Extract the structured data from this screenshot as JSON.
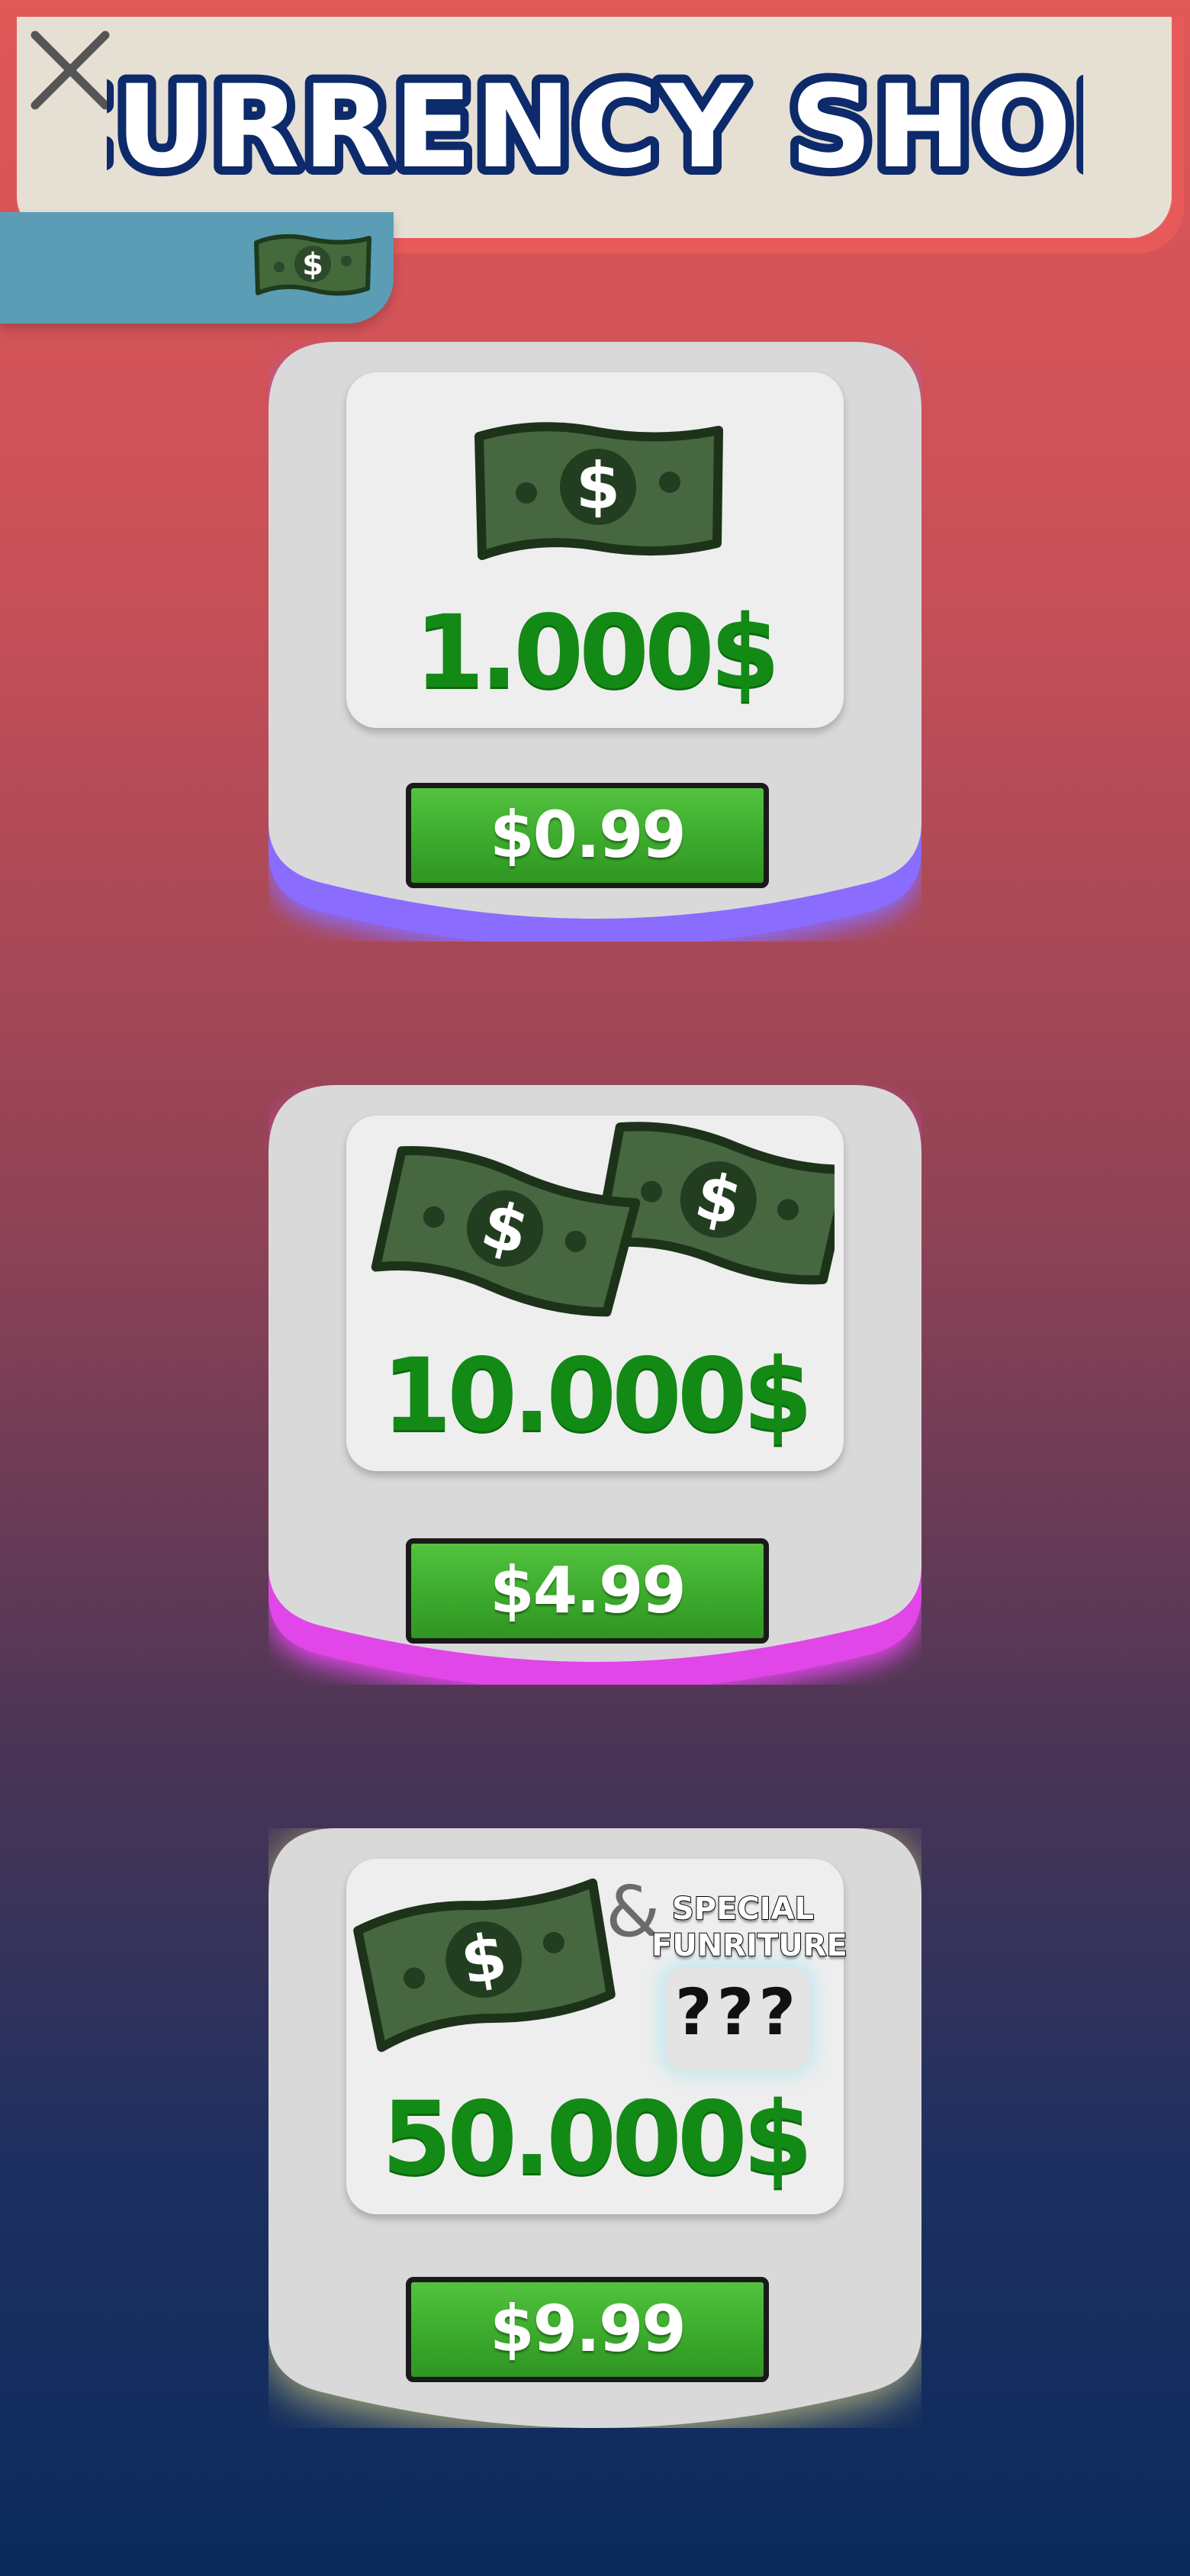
{
  "header": {
    "title": "CURRENCY SHOP",
    "close_icon": "close-x-icon"
  },
  "wallet": {
    "icon": "cash-icon"
  },
  "offers": [
    {
      "amount": "1.000$",
      "price": "$0.99",
      "glow_color": "#8a6cff",
      "icon": "single-bill-icon"
    },
    {
      "amount": "10.000$",
      "price": "$4.99",
      "glow_color": "#e046e8",
      "icon": "double-bill-icon"
    },
    {
      "amount": "50.000$",
      "price": "$9.99",
      "glow_color": "#d8d080",
      "icon": "single-bill-icon",
      "bonus": {
        "ampersand": "&",
        "label_line1": "SPECIAL",
        "label_line2": "FUNRITURE",
        "mystery": "???"
      }
    }
  ],
  "colors": {
    "amount_green": "#138a15",
    "button_green": "#3caa2d",
    "card_grey": "#d9d9d9",
    "title_navy": "#0d2a6b"
  }
}
